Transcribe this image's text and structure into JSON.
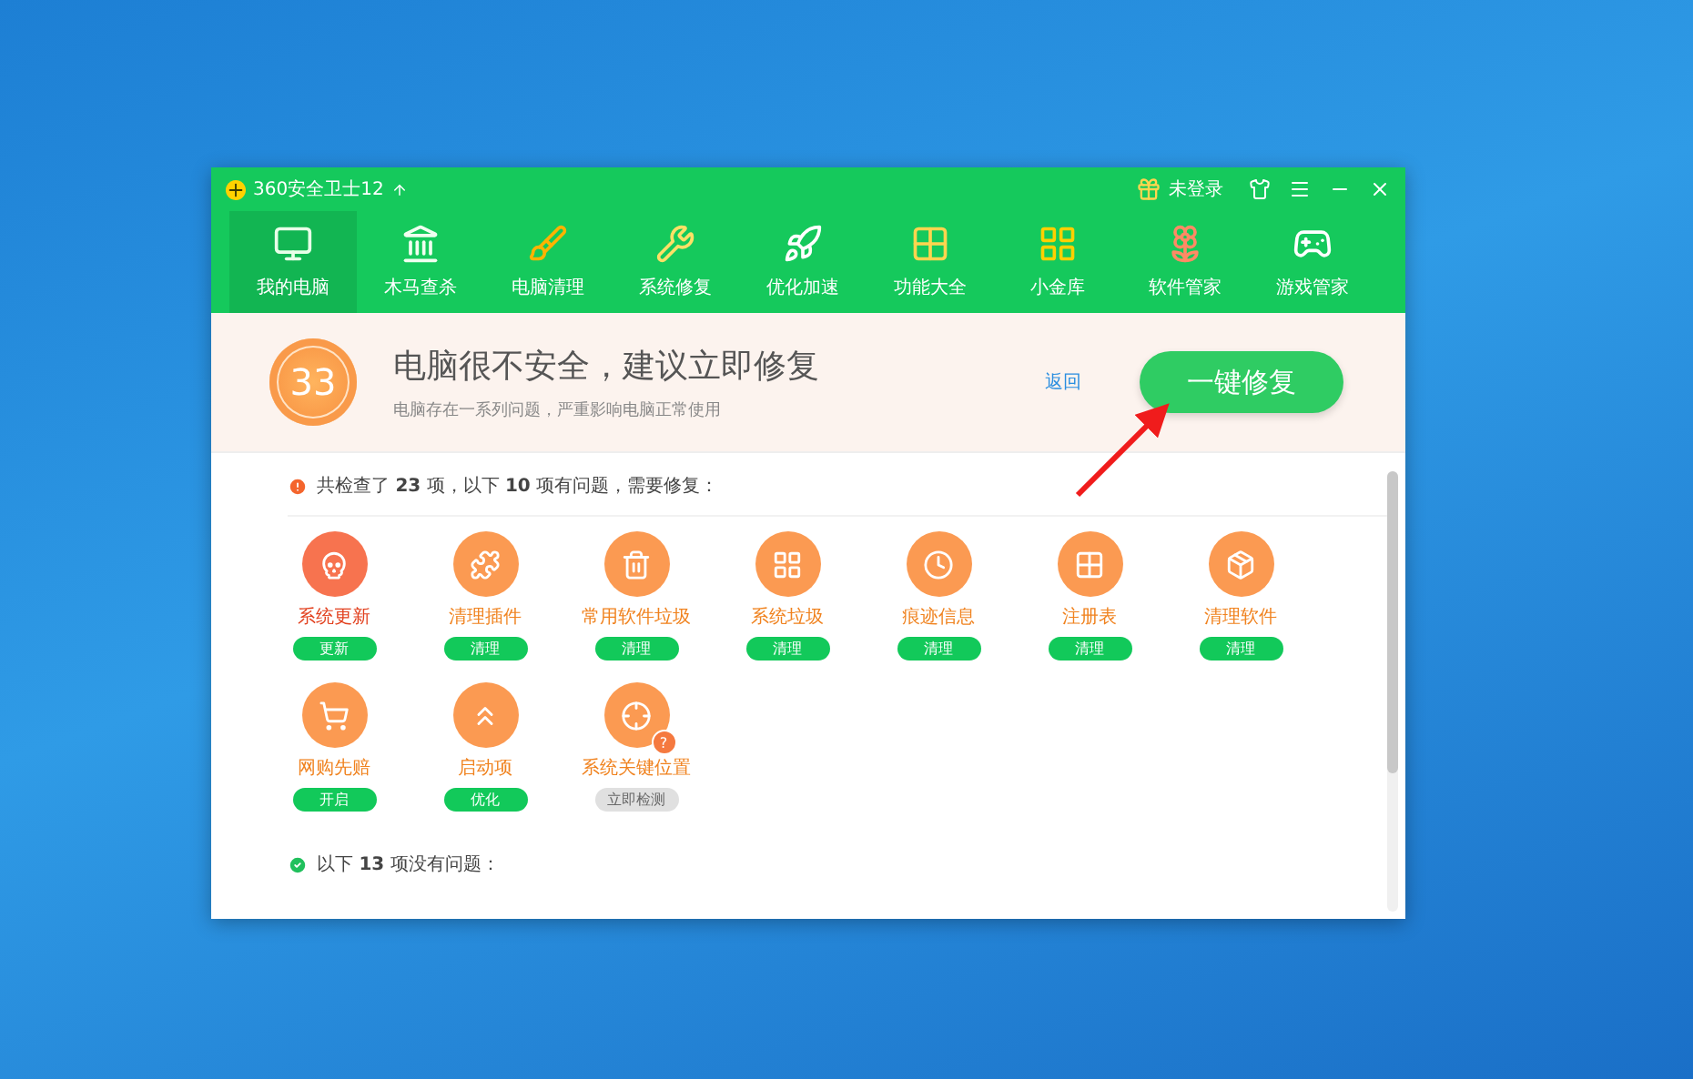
{
  "window": {
    "title": "360安全卫士12",
    "user": "未登录"
  },
  "nav": [
    {
      "label": "我的电脑",
      "kind": "monitor",
      "selected": true
    },
    {
      "label": "木马查杀",
      "kind": "horse",
      "selected": false
    },
    {
      "label": "电脑清理",
      "kind": "brush",
      "selected": false
    },
    {
      "label": "系统修复",
      "kind": "tools",
      "selected": false
    },
    {
      "label": "优化加速",
      "kind": "rocket",
      "selected": false
    },
    {
      "label": "功能大全",
      "kind": "grid",
      "selected": false
    },
    {
      "label": "小金库",
      "kind": "coin",
      "selected": false
    },
    {
      "label": "软件管家",
      "kind": "flower",
      "selected": false
    },
    {
      "label": "游戏管家",
      "kind": "gamepad",
      "selected": false
    }
  ],
  "status": {
    "score": "33",
    "headline": "电脑很不安全，建议立即修复",
    "subline": "电脑存在一系列问题，严重影响电脑正常使用",
    "back": "返回",
    "fix_button": "一键修复"
  },
  "problems": {
    "summary": "共检查了 **23** 项，以下 **10** 项有问题，需要修复：",
    "items": [
      {
        "label": "系统更新",
        "kind": "skull",
        "severe": true,
        "action": "更新",
        "disabled": false
      },
      {
        "label": "清理插件",
        "kind": "puzzle",
        "severe": false,
        "action": "清理",
        "disabled": false
      },
      {
        "label": "常用软件垃圾",
        "kind": "trash",
        "severe": false,
        "action": "清理",
        "disabled": false
      },
      {
        "label": "系统垃圾",
        "kind": "windows",
        "severe": false,
        "action": "清理",
        "disabled": false
      },
      {
        "label": "痕迹信息",
        "kind": "clock",
        "severe": false,
        "action": "清理",
        "disabled": false
      },
      {
        "label": "注册表",
        "kind": "blocks",
        "severe": false,
        "action": "清理",
        "disabled": false
      },
      {
        "label": "清理软件",
        "kind": "box",
        "severe": false,
        "action": "清理",
        "disabled": false
      },
      {
        "label": "网购先赔",
        "kind": "cart",
        "severe": false,
        "action": "开启",
        "disabled": false
      },
      {
        "label": "启动项",
        "kind": "chevrons",
        "severe": false,
        "action": "优化",
        "disabled": false
      },
      {
        "label": "系统关键位置",
        "kind": "target",
        "severe": false,
        "action": "立即检测",
        "disabled": true,
        "badge": "?"
      }
    ]
  },
  "ok_section": {
    "summary": "以下 **13** 项没有问题："
  }
}
